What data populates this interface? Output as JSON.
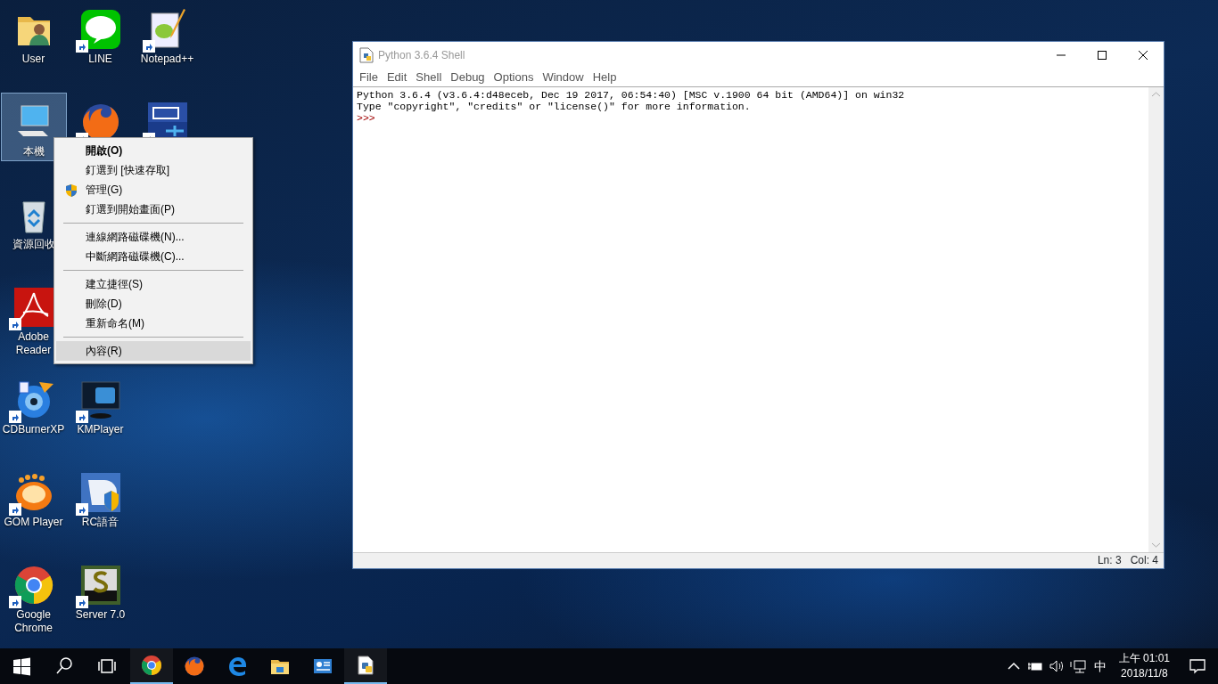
{
  "desktop": {
    "columns": [
      {
        "groups": [
          [
            {
              "kind": "user-folder",
              "label": "User",
              "shortcut": false,
              "selected": false
            },
            {
              "kind": "computer",
              "label": "本機",
              "shortcut": false,
              "selected": true
            },
            {
              "kind": "recycle",
              "label": "資源回收",
              "shortcut": false,
              "selected": false
            },
            {
              "kind": "adobe",
              "label": "Adobe Reader",
              "shortcut": true,
              "selected": false
            },
            {
              "kind": "cdburner",
              "label": "CDBurnerXP",
              "shortcut": true,
              "selected": false
            },
            {
              "kind": "gom",
              "label": "GOM Player",
              "shortcut": true,
              "selected": false
            },
            {
              "kind": "chrome",
              "label": "Google Chrome",
              "shortcut": true,
              "selected": false
            }
          ]
        ]
      },
      {
        "groups": [
          [
            {
              "kind": "line",
              "label": "LINE",
              "shortcut": true,
              "selected": false
            },
            {
              "kind": "firefox",
              "shortcut": true,
              "selected": false
            }
          ],
          [
            {
              "kind": "kmp",
              "label": "KMPlayer",
              "shortcut": true,
              "selected": false
            },
            {
              "kind": "rc",
              "label": "RC語音",
              "shortcut": true,
              "selected": false
            },
            {
              "kind": "server",
              "label": "Server 7.0",
              "shortcut": true,
              "selected": false
            }
          ]
        ]
      },
      {
        "groups": [
          [
            {
              "kind": "notepad",
              "label": "Notepad++",
              "shortcut": true,
              "selected": false
            },
            {
              "kind": "dev",
              "shortcut": true,
              "selected": false
            }
          ]
        ]
      }
    ]
  },
  "context_menu": {
    "groups": [
      [
        {
          "label": "開啟(O)",
          "default": true,
          "shield": false,
          "selected": false
        },
        {
          "label": "釘選到 [快速存取]",
          "default": false,
          "shield": false,
          "selected": false
        },
        {
          "label": "管理(G)",
          "default": false,
          "shield": true,
          "selected": false
        },
        {
          "label": "釘選到開始畫面(P)",
          "default": false,
          "shield": false,
          "selected": false
        }
      ],
      [
        {
          "label": "連線網路磁碟機(N)...",
          "default": false,
          "shield": false,
          "selected": false
        },
        {
          "label": "中斷網路磁碟機(C)...",
          "default": false,
          "shield": false,
          "selected": false
        }
      ],
      [
        {
          "label": "建立捷徑(S)",
          "default": false,
          "shield": false,
          "selected": false
        },
        {
          "label": "刪除(D)",
          "default": false,
          "shield": false,
          "selected": false
        },
        {
          "label": "重新命名(M)",
          "default": false,
          "shield": false,
          "selected": false
        }
      ],
      [
        {
          "label": "內容(R)",
          "default": false,
          "shield": false,
          "selected": true
        }
      ]
    ]
  },
  "window": {
    "title": "Python 3.6.4 Shell",
    "menu": [
      "File",
      "Edit",
      "Shell",
      "Debug",
      "Options",
      "Window",
      "Help"
    ],
    "lines": [
      {
        "kind": "output",
        "text": "Python 3.6.4 (v3.6.4:d48eceb, Dec 19 2017, 06:54:40) [MSC v.1900 64 bit (AMD64)] on win32"
      },
      {
        "kind": "output",
        "text": "Type \"copyright\", \"credits\" or \"license()\" for more information."
      },
      {
        "kind": "prompt",
        "text": ">>>"
      }
    ],
    "status_bar": [
      "Ln: 3",
      "Col: 4"
    ]
  },
  "taskbar": {
    "items": [
      {
        "kind": "start",
        "active": false
      },
      {
        "kind": "search",
        "active": false
      },
      {
        "kind": "taskview",
        "active": false
      },
      {
        "kind": "chrome",
        "active": true
      },
      {
        "kind": "firefox",
        "active": false
      },
      {
        "kind": "edge",
        "active": false
      },
      {
        "kind": "explorer",
        "active": false
      },
      {
        "kind": "controlpanel",
        "active": false
      },
      {
        "kind": "python",
        "active": true
      }
    ],
    "tray": [
      {
        "kind": "chevron"
      },
      {
        "kind": "battery"
      },
      {
        "kind": "volume"
      },
      {
        "kind": "network"
      }
    ],
    "ime": "中",
    "time": "上午 01:01",
    "date": "2018/11/8"
  }
}
